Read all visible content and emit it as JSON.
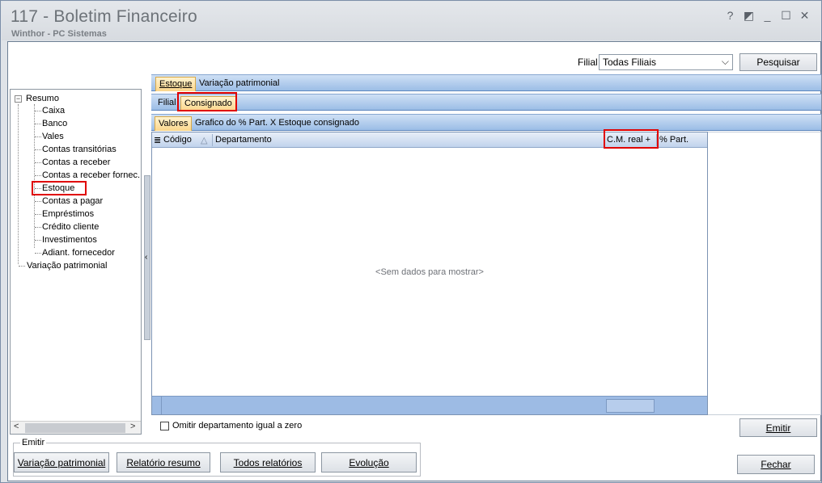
{
  "window": {
    "title": "117 - Boletim Financeiro",
    "subtitle": "Winthor - PC Sistemas",
    "controls": [
      "?",
      "◩",
      "_",
      "☐",
      "✕"
    ]
  },
  "filter": {
    "filial_label": "Filial",
    "filial_value": "Todas Filiais",
    "search_button": "Pesquisar"
  },
  "tree": {
    "root_label": "Resumo",
    "root_expander": "−",
    "items": [
      "Caixa",
      "Banco",
      "Vales",
      "Contas transitórias",
      "Contas a receber",
      "Contas a receber fornec.",
      "Estoque",
      "Contas a pagar",
      "Empréstimos",
      "Crédito cliente",
      "Investimentos",
      "Adiant. fornecedor"
    ],
    "second_root": "Variação patrimonial",
    "scroll_left": "<",
    "scroll_right": ">"
  },
  "tabs": {
    "main": [
      "Estoque",
      "Variação patrimonial"
    ],
    "sub": [
      "Filial",
      "Consignado"
    ],
    "view": [
      "Valores",
      "Grafico do % Part. X Estoque consignado"
    ]
  },
  "grid": {
    "row_indicator": "≣",
    "columns": [
      "Código",
      "Departamento",
      "C.M. real +",
      "% Part."
    ],
    "sort_glyph": "△",
    "empty_text": "<Sem dados para mostrar>"
  },
  "splitter_glyph": "‹",
  "options": {
    "omit_zero_label": "Omitir departamento igual a zero",
    "omit_zero_checked": false
  },
  "emitir_group": {
    "label": "Emitir",
    "buttons": [
      "Variação patrimonial",
      "Relatório resumo",
      "Todos relatórios",
      "Evolução"
    ]
  },
  "actions": {
    "emitir": "Emitir",
    "fechar": "Fechar"
  },
  "highlight_color": "#e00000"
}
